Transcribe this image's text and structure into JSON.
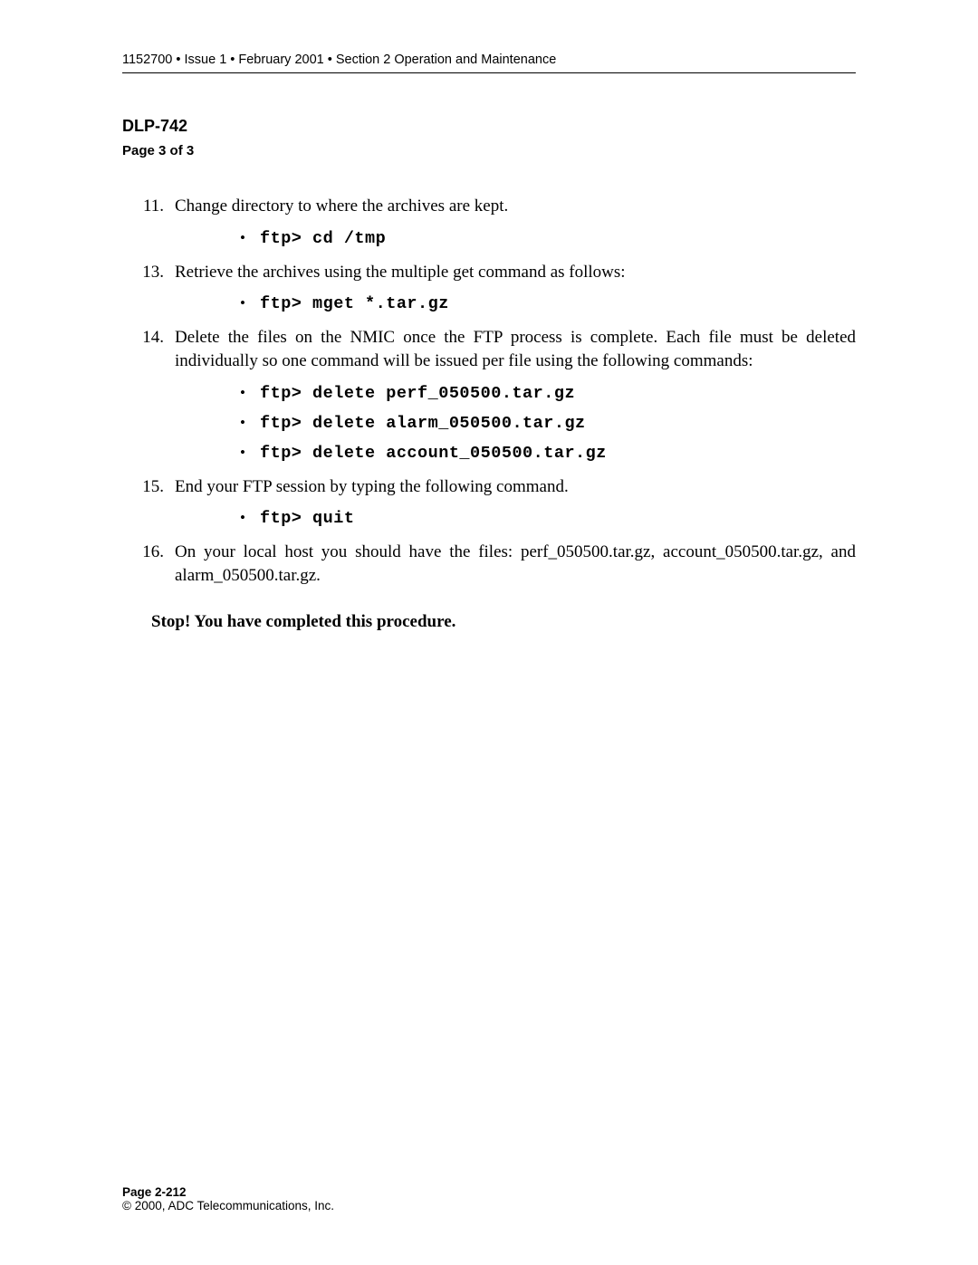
{
  "header": "1152700 • Issue 1 • February 2001 • Section 2 Operation and Maintenance",
  "title": "DLP-742",
  "subtitle": "Page 3 of 3",
  "steps": [
    {
      "num": "11.",
      "text": "Change directory to where the archives are kept.",
      "cmds": [
        "ftp> cd /tmp"
      ]
    },
    {
      "num": "13.",
      "text": "Retrieve the archives using the multiple get command as follows:",
      "cmds": [
        "ftp> mget *.tar.gz"
      ]
    },
    {
      "num": "14.",
      "text": "Delete the files on the NMIC once the FTP process is complete. Each file must be deleted individually so one command will be issued per file using the following commands:",
      "cmds": [
        "ftp> delete perf_050500.tar.gz",
        "ftp> delete alarm_050500.tar.gz",
        "ftp> delete account_050500.tar.gz"
      ]
    },
    {
      "num": "15.",
      "text": "End your FTP session by typing the following command.",
      "cmds": [
        "ftp> quit"
      ]
    },
    {
      "num": "16.",
      "text": "On your local host you should have the files: perf_050500.tar.gz, account_050500.tar.gz, and alarm_050500.tar.gz.",
      "cmds": []
    }
  ],
  "completion": "Stop! You have completed this procedure.",
  "footer_page": "Page 2-212",
  "footer_copy": "© 2000, ADC Telecommunications, Inc."
}
